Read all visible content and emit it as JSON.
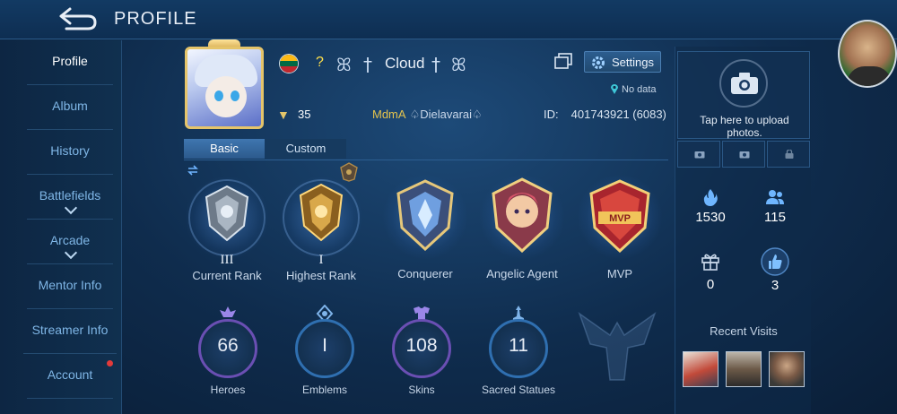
{
  "header": {
    "title": "PROFILE",
    "back_icon": "back-arrow-icon"
  },
  "sidebar": {
    "items": [
      {
        "label": "Profile",
        "active": true,
        "expandable": false
      },
      {
        "label": "Album",
        "active": false,
        "expandable": false
      },
      {
        "label": "History",
        "active": false,
        "expandable": false
      },
      {
        "label": "Battlefields",
        "active": false,
        "expandable": true
      },
      {
        "label": "Arcade",
        "active": false,
        "expandable": true
      },
      {
        "label": "Mentor Info",
        "active": false,
        "expandable": false
      },
      {
        "label": "Streamer Info",
        "active": false,
        "expandable": false
      },
      {
        "label": "Account",
        "active": false,
        "expandable": false,
        "notification": true
      }
    ]
  },
  "profile": {
    "name": "Cloud",
    "flag_colors": [
      "#fdb913",
      "#006a44",
      "#c1272d"
    ],
    "unknown_mark": "?",
    "level": "35",
    "squad": "MdmA",
    "squad_suffix": "Dielavarai",
    "id_label": "ID:",
    "id_value": "401743921 (6083)",
    "location": "No data",
    "settings_label": "Settings"
  },
  "tabs": [
    {
      "label": "Basic",
      "active": true
    },
    {
      "label": "Custom",
      "active": false
    }
  ],
  "medals": [
    {
      "roman": "III",
      "label": "Current Rank"
    },
    {
      "roman": "I",
      "label": "Highest Rank"
    },
    {
      "roman": "",
      "label": "Conquerer"
    },
    {
      "roman": "",
      "label": "Angelic Agent"
    },
    {
      "roman": "",
      "label": "MVP"
    }
  ],
  "stats": [
    {
      "value": "66",
      "label": "Heroes"
    },
    {
      "value": "I",
      "label": "Emblems"
    },
    {
      "value": "108",
      "label": "Skins"
    },
    {
      "value": "11",
      "label": "Sacred Statues"
    }
  ],
  "right_panel": {
    "upload_text_1": "Tap here to upload",
    "upload_text_2": "photos.",
    "popularity": "1530",
    "friends": "115",
    "gifts": "0",
    "likes": "3",
    "recent_visits_title": "Recent Visits"
  }
}
